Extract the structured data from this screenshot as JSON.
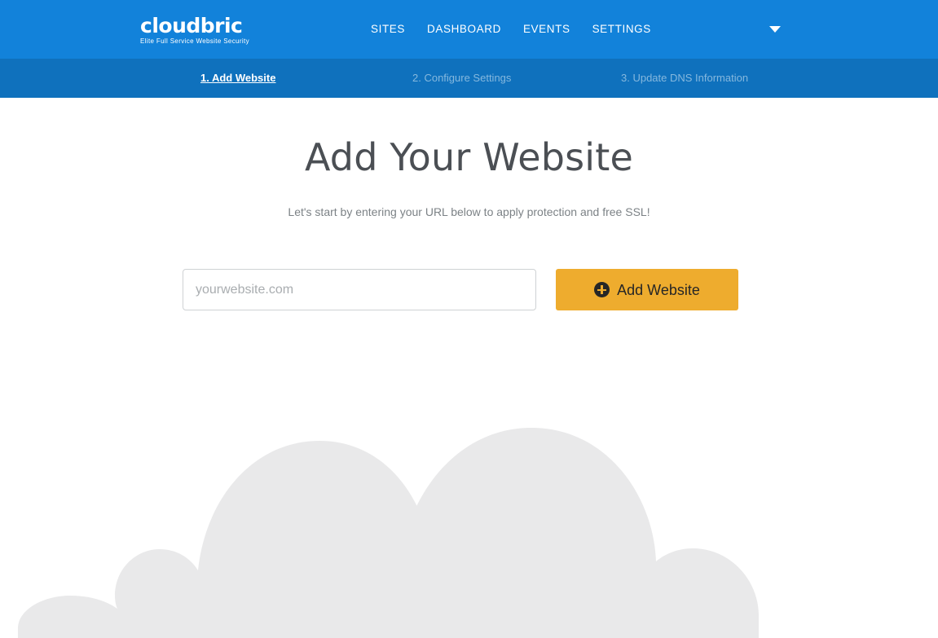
{
  "header": {
    "logo": {
      "wordmark": "cloudbric",
      "tagline": "Elite Full Service Website Security"
    },
    "nav": [
      {
        "label": "SITES"
      },
      {
        "label": "DASHBOARD"
      },
      {
        "label": "EVENTS"
      },
      {
        "label": "SETTINGS"
      }
    ],
    "account_menu_icon": "chevron-down-icon",
    "background_color": "#1282da"
  },
  "steps": {
    "background_color": "#0f71bd",
    "items": [
      {
        "label": "1. Add Website",
        "state": "active"
      },
      {
        "label": "2. Configure Settings",
        "state": "inactive"
      },
      {
        "label": "3. Update DNS Information",
        "state": "inactive"
      }
    ]
  },
  "main": {
    "title": "Add Your Website",
    "subtitle": "Let's start by entering your URL below to apply protection and free SSL!",
    "url_field": {
      "placeholder": "yourwebsite.com",
      "value": ""
    },
    "add_button": {
      "label": "Add Website",
      "icon": "plus-circle-icon",
      "background_color": "#eeac2e",
      "text_color": "#262626"
    }
  },
  "illustration": {
    "name": "cloud-illustration",
    "color": "#e9e9ea"
  }
}
